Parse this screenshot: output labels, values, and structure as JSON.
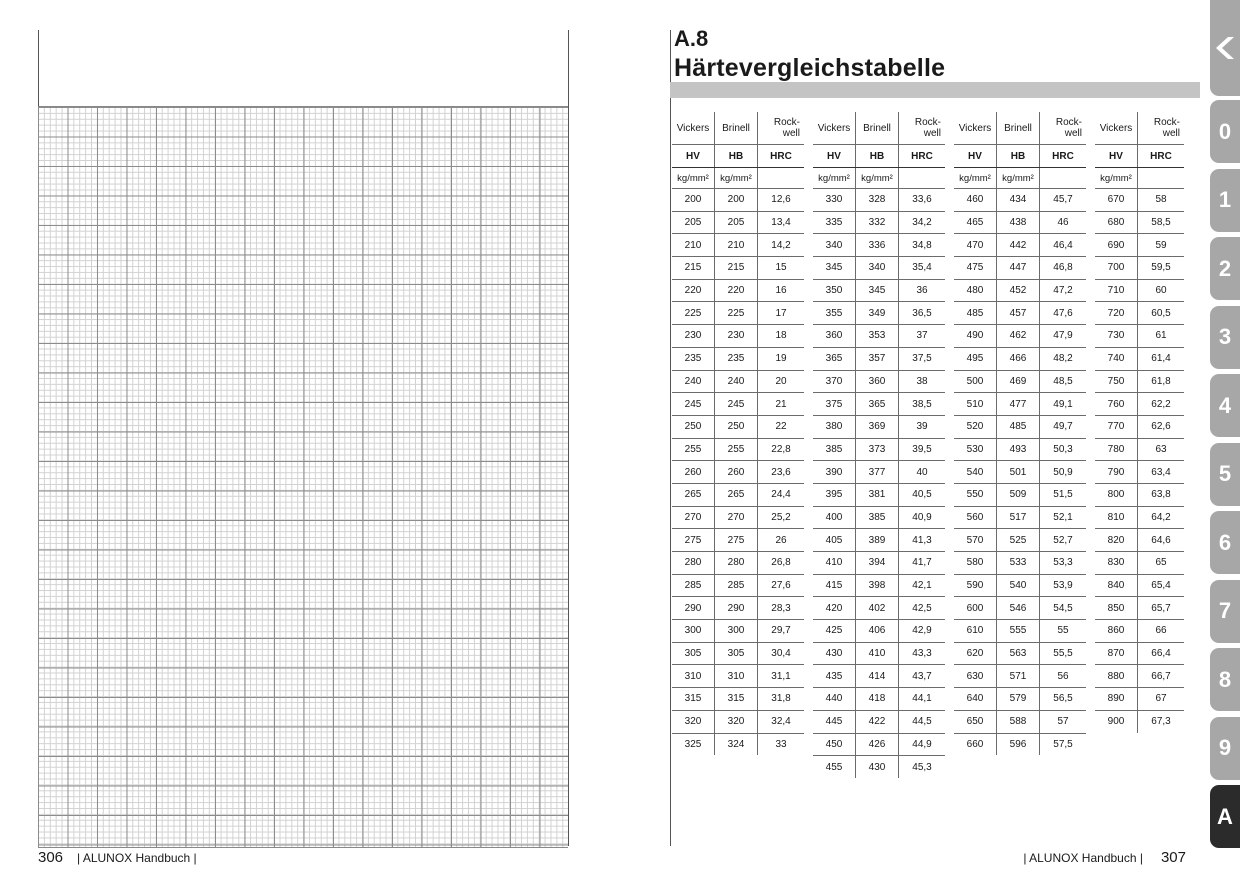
{
  "left_page": {
    "page_number": "306",
    "footer_text": "| ALUNOX Handbuch |"
  },
  "right_page": {
    "section_number": "A.8",
    "section_title": "Härtevergleichstabelle",
    "page_number": "307",
    "footer_text": "| ALUNOX Handbuch |"
  },
  "table": {
    "headers": {
      "vickers": "Vickers",
      "brinell": "Brinell",
      "rockwell_1": "Rock-",
      "rockwell_2": "well",
      "hv": "HV",
      "hb": "HB",
      "hrc": "HRC",
      "unit": "kg/mm²"
    },
    "block1": [
      [
        "200",
        "200",
        "12,6"
      ],
      [
        "205",
        "205",
        "13,4"
      ],
      [
        "210",
        "210",
        "14,2"
      ],
      [
        "215",
        "215",
        "15"
      ],
      [
        "220",
        "220",
        "16"
      ],
      [
        "225",
        "225",
        "17"
      ],
      [
        "230",
        "230",
        "18"
      ],
      [
        "235",
        "235",
        "19"
      ],
      [
        "240",
        "240",
        "20"
      ],
      [
        "245",
        "245",
        "21"
      ],
      [
        "250",
        "250",
        "22"
      ],
      [
        "255",
        "255",
        "22,8"
      ],
      [
        "260",
        "260",
        "23,6"
      ],
      [
        "265",
        "265",
        "24,4"
      ],
      [
        "270",
        "270",
        "25,2"
      ],
      [
        "275",
        "275",
        "26"
      ],
      [
        "280",
        "280",
        "26,8"
      ],
      [
        "285",
        "285",
        "27,6"
      ],
      [
        "290",
        "290",
        "28,3"
      ],
      [
        "300",
        "300",
        "29,7"
      ],
      [
        "305",
        "305",
        "30,4"
      ],
      [
        "310",
        "310",
        "31,1"
      ],
      [
        "315",
        "315",
        "31,8"
      ],
      [
        "320",
        "320",
        "32,4"
      ],
      [
        "325",
        "324",
        "33"
      ]
    ],
    "block2": [
      [
        "330",
        "328",
        "33,6"
      ],
      [
        "335",
        "332",
        "34,2"
      ],
      [
        "340",
        "336",
        "34,8"
      ],
      [
        "345",
        "340",
        "35,4"
      ],
      [
        "350",
        "345",
        "36"
      ],
      [
        "355",
        "349",
        "36,5"
      ],
      [
        "360",
        "353",
        "37"
      ],
      [
        "365",
        "357",
        "37,5"
      ],
      [
        "370",
        "360",
        "38"
      ],
      [
        "375",
        "365",
        "38,5"
      ],
      [
        "380",
        "369",
        "39"
      ],
      [
        "385",
        "373",
        "39,5"
      ],
      [
        "390",
        "377",
        "40"
      ],
      [
        "395",
        "381",
        "40,5"
      ],
      [
        "400",
        "385",
        "40,9"
      ],
      [
        "405",
        "389",
        "41,3"
      ],
      [
        "410",
        "394",
        "41,7"
      ],
      [
        "415",
        "398",
        "42,1"
      ],
      [
        "420",
        "402",
        "42,5"
      ],
      [
        "425",
        "406",
        "42,9"
      ],
      [
        "430",
        "410",
        "43,3"
      ],
      [
        "435",
        "414",
        "43,7"
      ],
      [
        "440",
        "418",
        "44,1"
      ],
      [
        "445",
        "422",
        "44,5"
      ],
      [
        "450",
        "426",
        "44,9"
      ],
      [
        "455",
        "430",
        "45,3"
      ]
    ],
    "block3": [
      [
        "460",
        "434",
        "45,7"
      ],
      [
        "465",
        "438",
        "46"
      ],
      [
        "470",
        "442",
        "46,4"
      ],
      [
        "475",
        "447",
        "46,8"
      ],
      [
        "480",
        "452",
        "47,2"
      ],
      [
        "485",
        "457",
        "47,6"
      ],
      [
        "490",
        "462",
        "47,9"
      ],
      [
        "495",
        "466",
        "48,2"
      ],
      [
        "500",
        "469",
        "48,5"
      ],
      [
        "510",
        "477",
        "49,1"
      ],
      [
        "520",
        "485",
        "49,7"
      ],
      [
        "530",
        "493",
        "50,3"
      ],
      [
        "540",
        "501",
        "50,9"
      ],
      [
        "550",
        "509",
        "51,5"
      ],
      [
        "560",
        "517",
        "52,1"
      ],
      [
        "570",
        "525",
        "52,7"
      ],
      [
        "580",
        "533",
        "53,3"
      ],
      [
        "590",
        "540",
        "53,9"
      ],
      [
        "600",
        "546",
        "54,5"
      ],
      [
        "610",
        "555",
        "55"
      ],
      [
        "620",
        "563",
        "55,5"
      ],
      [
        "630",
        "571",
        "56"
      ],
      [
        "640",
        "579",
        "56,5"
      ],
      [
        "650",
        "588",
        "57"
      ],
      [
        "660",
        "596",
        "57,5"
      ]
    ],
    "block4": [
      [
        "670",
        "58"
      ],
      [
        "680",
        "58,5"
      ],
      [
        "690",
        "59"
      ],
      [
        "700",
        "59,5"
      ],
      [
        "710",
        "60"
      ],
      [
        "720",
        "60,5"
      ],
      [
        "730",
        "61"
      ],
      [
        "740",
        "61,4"
      ],
      [
        "750",
        "61,8"
      ],
      [
        "760",
        "62,2"
      ],
      [
        "770",
        "62,6"
      ],
      [
        "780",
        "63"
      ],
      [
        "790",
        "63,4"
      ],
      [
        "800",
        "63,8"
      ],
      [
        "810",
        "64,2"
      ],
      [
        "820",
        "64,6"
      ],
      [
        "830",
        "65"
      ],
      [
        "840",
        "65,4"
      ],
      [
        "850",
        "65,7"
      ],
      [
        "860",
        "66"
      ],
      [
        "870",
        "66,4"
      ],
      [
        "880",
        "66,7"
      ],
      [
        "890",
        "67"
      ],
      [
        "900",
        "67,3"
      ]
    ]
  },
  "tabs": [
    "0",
    "1",
    "2",
    "3",
    "4",
    "5",
    "6",
    "7",
    "8",
    "9",
    "A"
  ],
  "active_tab": "A",
  "colors": {
    "tab": "#a7a7a7",
    "tab_active": "#2b2b2b",
    "band": "#c4c4c4"
  }
}
